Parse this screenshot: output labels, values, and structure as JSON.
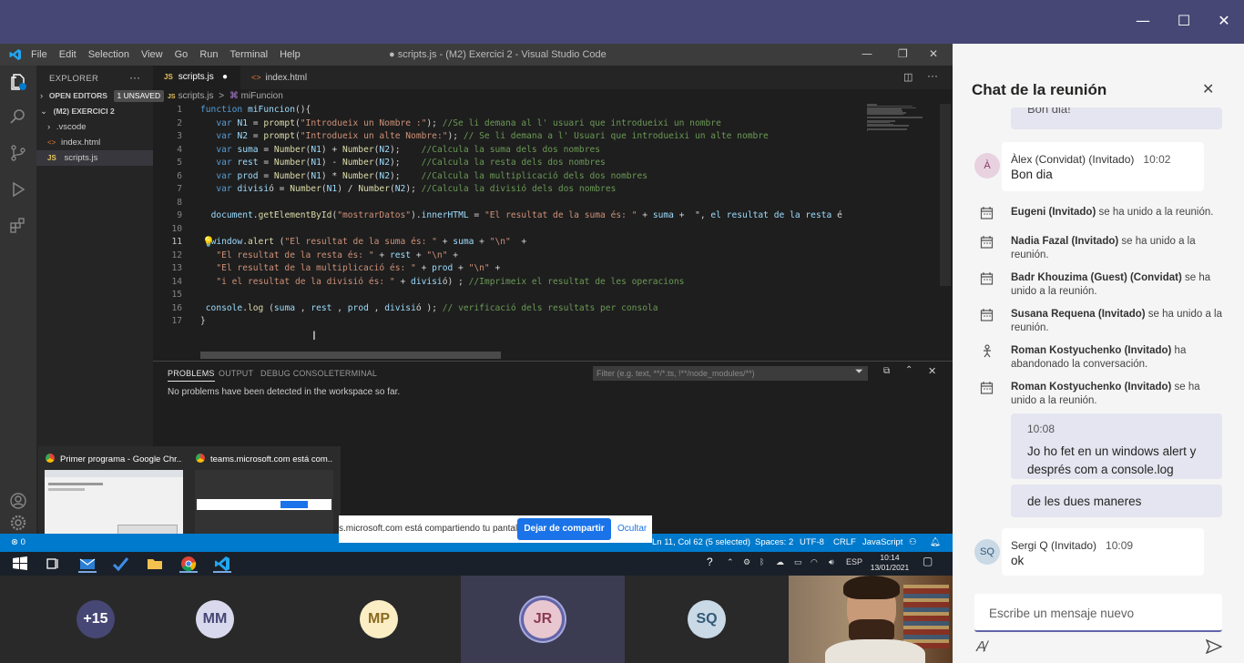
{
  "teams": {
    "window_controls": {
      "minimize": "—",
      "maximize": "☐",
      "close": "✕"
    }
  },
  "vscode": {
    "menu": [
      "File",
      "Edit",
      "Selection",
      "View",
      "Go",
      "Run",
      "Terminal",
      "Help"
    ],
    "window_title": "● scripts.js - (M2) Exercici 2 - Visual Studio Code",
    "explorer": {
      "header": "EXPLORER",
      "open_editors": "OPEN EDITORS",
      "unsaved_badge": "1 UNSAVED",
      "folder": "(M2) EXERCICI 2",
      "items": [
        ".vscode",
        "index.html",
        "scripts.js"
      ]
    },
    "tabs": [
      {
        "badge": "JS",
        "label": "scripts.js",
        "modified": "●"
      },
      {
        "badge": "<>",
        "label": "index.html"
      }
    ],
    "breadcrumb": {
      "file": "scripts.js",
      "separator": ">",
      "symbol": "miFuncion"
    },
    "code_lines": [
      {
        "n": "1",
        "text": "function miFuncion(){"
      },
      {
        "n": "2",
        "text": "   var N1 = prompt(\"Introdueix un Nombre :\"); //Se li demana al l' usuari que introdueixi un nombre"
      },
      {
        "n": "3",
        "text": "   var N2 = prompt(\"Introdueix un alte Nombre:\"); // Se li demana a l' Usuari que introdueixi un alte nombre"
      },
      {
        "n": "4",
        "text": "   var suma = Number(N1) + Number(N2);    //Calcula la suma dels dos nombres"
      },
      {
        "n": "5",
        "text": "   var rest = Number(N1) - Number(N2);    //Calcula la resta dels dos nombres"
      },
      {
        "n": "6",
        "text": "   var prod = Number(N1) * Number(N2);    //Calcula la multiplicació dels dos nombres"
      },
      {
        "n": "7",
        "text": "   var divisió = Number(N1) / Number(N2); //Calcula la divisió dels dos nombres"
      },
      {
        "n": "8",
        "text": ""
      },
      {
        "n": "9",
        "text": "  document.getElementById(\"mostrarDatos\").innerHTML = \"El resultat de la suma és: \" + suma +  \", el resultat de la resta é"
      },
      {
        "n": "10",
        "text": ""
      },
      {
        "n": "11",
        "text": "  window.alert (\"El resultat de la suma és: \" + suma + \"\\n\"  +"
      },
      {
        "n": "12",
        "text": "   \"El resultat de la resta és: \" + rest + \"\\n\" +"
      },
      {
        "n": "13",
        "text": "   \"El resultat de la multiplicació és: \" + prod + \"\\n\" +"
      },
      {
        "n": "14",
        "text": "   \"i el resultat de la divisió és: \" + divisió) ; //Imprimeix el resultat de les operacions"
      },
      {
        "n": "15",
        "text": ""
      },
      {
        "n": "16",
        "text": " console.log (suma , rest , prod , divisió ); // verificació dels resultats per consola"
      },
      {
        "n": "17",
        "text": "}"
      }
    ],
    "panel": {
      "tabs": [
        "PROBLEMS",
        "OUTPUT",
        "DEBUG CONSOLE",
        "TERMINAL"
      ],
      "filter_placeholder": "Filter (e.g. text, **/*.ts, !**/node_modules/**)",
      "message": "No problems have been detected in the workspace so far."
    },
    "status": {
      "errors": "⊗ 0",
      "position": "Ln 11, Col 62 (5 selected)",
      "spaces": "Spaces: 2",
      "encoding": "UTF-8",
      "eol": "CRLF",
      "language": "JavaScript"
    }
  },
  "previews": [
    {
      "title": "Primer programa - Google Chr..."
    },
    {
      "title": "teams.microsoft.com está com..."
    }
  ],
  "sharebar": {
    "text": "s.microsoft.com está compartiendo tu pantalla.",
    "stop": "Dejar de compartir",
    "hide": "Ocultar"
  },
  "taskbar": {
    "lang": "ESP",
    "time": "10:14",
    "date": "13/01/2021"
  },
  "chat": {
    "title": "Chat de la reunión",
    "prev_msg_tail": "Bon dia!",
    "messages": [
      {
        "sender": "Àlex (Convidat) (Invitado)",
        "time": "10:02",
        "text": "Bon dia",
        "avatar": "À"
      }
    ],
    "system": [
      {
        "name": "Eugeni (Invitado)",
        "text": " se ha unido a la reunión."
      },
      {
        "name": "Nadia Fazal (Invitado)",
        "text": " se ha unido a la reunión."
      },
      {
        "name": "Badr Khouzima (Guest) (Convidat)",
        "text": " se ha unido a la reunión."
      },
      {
        "name": "Susana Requena (Invitado)",
        "text": " se ha unido a la reunión."
      },
      {
        "name": "Roman Kostyuchenko (Invitado)",
        "text": " ha abandonado la conversación."
      },
      {
        "name": "Roman Kostyuchenko (Invitado)",
        "text": " se ha unido a la reunión."
      }
    ],
    "my_messages": [
      {
        "time": "10:08",
        "text": "Jo ho fet en un windows alert y després com a console.log"
      },
      {
        "text": "de les dues maneres"
      }
    ],
    "last": {
      "sender": "Sergi Q (Invitado)",
      "time": "10:09",
      "text": "ok",
      "avatar": "SQ"
    },
    "compose_placeholder": "Escribe un mensaje nuevo"
  },
  "participants": [
    {
      "label": "+15",
      "bg": "#464775",
      "fg": "#ffffff"
    },
    {
      "label": "MM",
      "bg": "#d9d9ee",
      "fg": "#464775"
    },
    {
      "label": "MP",
      "bg": "#fbeec5",
      "fg": "#8a6a1f"
    },
    {
      "label": "JR",
      "bg": "#e8c7d1",
      "fg": "#8a3b52"
    },
    {
      "label": "SQ",
      "bg": "#c9d9e6",
      "fg": "#335a77"
    }
  ],
  "colors": {
    "teams_purple": "#464775",
    "vscode_blue": "#007acc",
    "chrome_blue": "#1a73e8"
  }
}
